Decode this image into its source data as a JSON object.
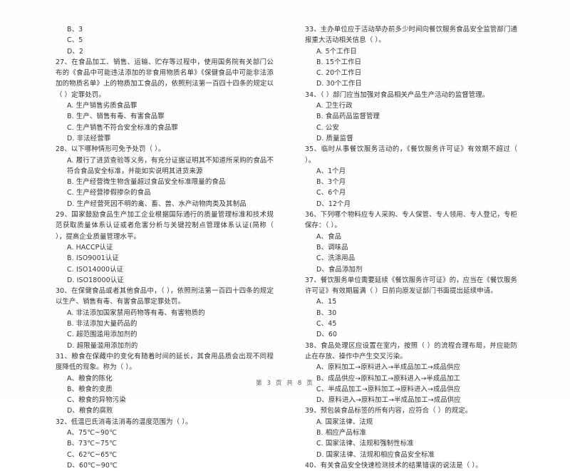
{
  "document": {
    "type": "exam-paper",
    "language": "zh-CN",
    "footer": "第 3 页 共 8 页",
    "page_number": "3",
    "total_pages": "8"
  },
  "left_column": {
    "questions": [
      {
        "number": "",
        "stem": "",
        "options": [
          "B、3",
          "C、5",
          "D、2"
        ]
      },
      {
        "number": "27",
        "stem": "27、在食品加工、销售、运输、贮存等过程中，使用国务院有关部门公布的《食品中可能违法添加的非食用物质名单》《保健食品中可能非法添加的物质名单》上的物质加工食品的，依照刑法第一百四十四条的规定以（      ）定罪处罚。",
        "options": [
          "A. 生产销售劣质食品罪",
          "B. 生产、销售有毒、有害食品罪",
          "C. 生产销售不符合安全标准的食品罪",
          "D. 非法经营罪"
        ]
      },
      {
        "number": "28",
        "stem": "28、以下哪种情形可免予处罚（      ）。",
        "options": [
          "A. 履行了进货查验等义务，有充分证据证明其不知道所采购的食品不符合食品安全标准，并能如实说明其进货来源",
          "B. 生产经营微生物含量超过食品安全标准限量的食品",
          "C. 生产经营掺假掺杂的食品",
          "D. 生产经营死因不明的禽、畜、兽、水产动物肉类及其制品"
        ]
      },
      {
        "number": "29",
        "stem": "29、国家鼓励食品生产加工企业根据国际通行的质量管理标准和技术规范获取质量体系认证或者危害分析与关键控制点管理体系认证(简称（      ），提高企业质量管理水平。",
        "options": [
          "A. HACCP认证",
          "B. ISO9001认证",
          "C. ISO14000认证",
          "D. ISO18000认证"
        ]
      },
      {
        "number": "30",
        "stem": "30、在保健食品或者其他食品中，（      ），依照刑法第一百四十四条的规定以生产、销售有毒、有害食品罪定罪处罚。",
        "options": [
          "A. 非法添加国家禁用药物等有毒、有害物质的",
          "B. 非法添加大量药品的",
          "C. 超范围滥用添加剂的",
          "D. 超限量滥用添加剂的"
        ]
      },
      {
        "number": "31",
        "stem": "31、粮食在保藏中的变化有随着时间的延长，其食用品质会出现不同程度降低的现象。称为（      ）。",
        "options": [
          "A、粮食的陈化",
          "B、粮食的变质",
          "C、粮食的异物污染",
          "D、粮食的腐败"
        ]
      },
      {
        "number": "32",
        "stem": "32、低温巴氏消毒法消毒的温度范围为（      ）。",
        "options": [
          "A、75℃~90℃",
          "B、73℃~75℃",
          "C、62℃~65℃",
          "D、60℃~90℃"
        ]
      }
    ]
  },
  "right_column": {
    "questions": [
      {
        "number": "33",
        "stem": "33、主办单位应于活动举办前多少时间向餐饮服务食品安全监管部门通报重大活动相关信息（      ）。",
        "options": [
          "A. 5个工作日",
          "B. 15个工作日",
          "C. 20个工作日",
          "D. 30个工作日"
        ]
      },
      {
        "number": "34",
        "stem": "34、（      ）部门应当加强对食品相关产品生产活动的监督管理。",
        "options": [
          "A. 卫生行政",
          "B. 食品药品监督管理",
          "C. 公安",
          "D. 质量监督"
        ]
      },
      {
        "number": "35",
        "stem": "35、临时从事餐饮服务活动的，《餐饮服务许可证》有效期不超过（      ）。",
        "options": [
          "A、1个月",
          "B、3个月",
          "C、6个月",
          "D、12个月"
        ]
      },
      {
        "number": "36",
        "stem": "36、下列哪个物料应专人采购、专人保管、专人领用、专人登记，专柜保存：（      ）。",
        "options": [
          "A、食品",
          "B、调味品",
          "C、洗涤用品",
          "D、食品添加剂"
        ]
      },
      {
        "number": "37",
        "stem": "37、餐饮服务单位需要延续《餐饮服务许可证》的，应当在《餐饮服务许可证》有效期届满（      ）日前向原发证部门书面提出延续申请。",
        "options": [
          "A、15",
          "B、30",
          "C、45",
          "D、60"
        ]
      },
      {
        "number": "38",
        "stem": "38、食品处理区应设置在室内，按照（      ）的流程合理布局，并应能防止在存放、操作中产生交叉污染。",
        "options": [
          "A、原料加工→原料进入→半成品加工→成品供应",
          "B、成品供应→原料加工→原料进入→半成品加工",
          "C、半成品加工→原料加工→原料进入→成品供应",
          "D、原料进入→原料加工→半成品加工→成品供应"
        ]
      },
      {
        "number": "39",
        "stem": "39、预包装食品标签的所有内容，应符合（      ）的规定。",
        "options": [
          "A. 国家法律、法规",
          "B. 相应产品标准",
          "C. 国家法律、法规和强制性标准",
          "D. 国家法律、法规和相应食品安全标准"
        ]
      },
      {
        "number": "40",
        "stem": "40、有关食品安全快速检测技术的结果错误的说法是（      ）。",
        "options": []
      }
    ]
  }
}
